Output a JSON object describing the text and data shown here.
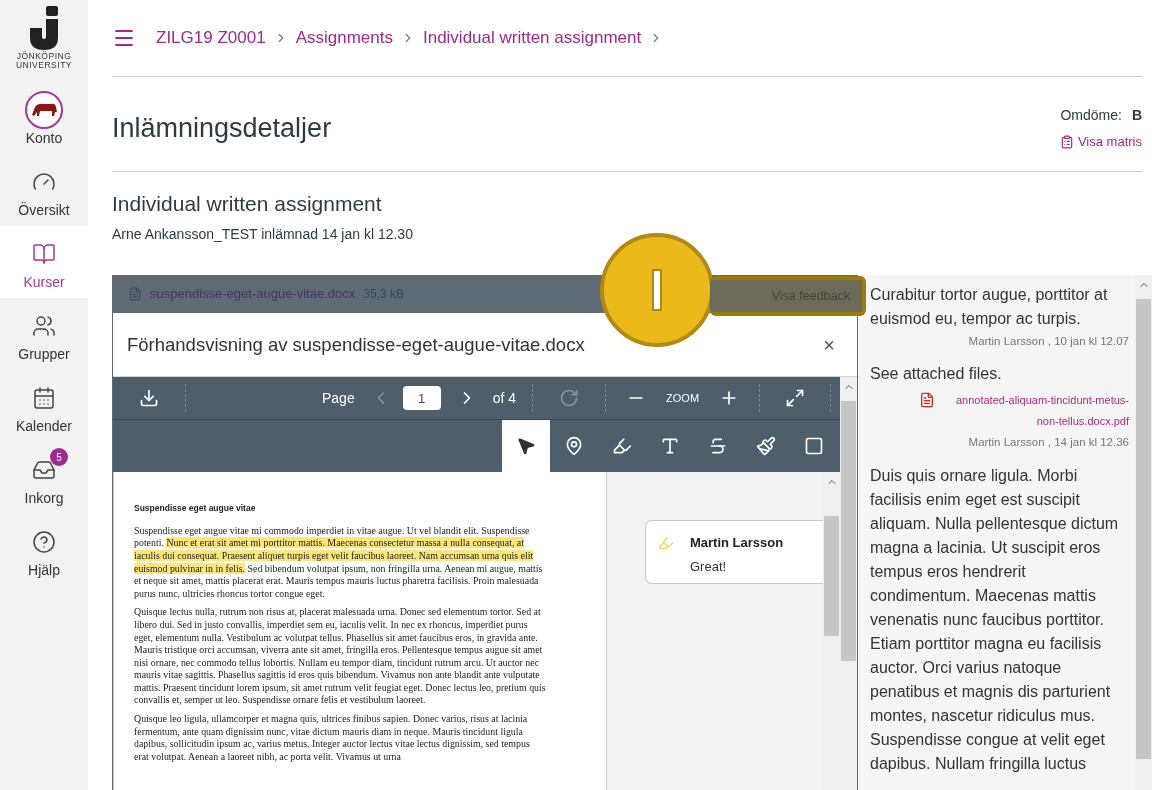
{
  "sidebar": {
    "logo_lines": [
      "JÖNKÖPING",
      "UNIVERSITY"
    ],
    "items": [
      {
        "kind": "avatar",
        "label": "Konto",
        "selected": false
      },
      {
        "kind": "dashboard",
        "label": "Översikt",
        "selected": false
      },
      {
        "kind": "courses",
        "label": "Kurser",
        "selected": true
      },
      {
        "kind": "groups",
        "label": "Grupper",
        "selected": false
      },
      {
        "kind": "calendar",
        "label": "Kalender",
        "selected": false
      },
      {
        "kind": "inbox",
        "label": "Inkorg",
        "selected": false,
        "badge": "5"
      },
      {
        "kind": "help",
        "label": "Hjälp",
        "selected": false
      }
    ]
  },
  "breadcrumb": [
    "ZILG19 Z0001",
    "Assignments",
    "Individual written assignment"
  ],
  "page_title": "Inlämningsdetaljer",
  "grade": {
    "label": "Omdöme:",
    "value": "B",
    "link": "Visa matris"
  },
  "assignment": {
    "title": "Individual written assignment",
    "submitted": "Arne Ankansson_TEST inlämnad 14 jan kl 12.30"
  },
  "file": {
    "name": "suspendisse-eget-augue-vitae.docx",
    "size": "35,3 kB",
    "feedback_button": "Visa feedback"
  },
  "preview": {
    "title": "Förhandsvisning av suspendisse-eget-augue-vitae.docx",
    "close": "×",
    "toolbar": {
      "page_label": "Page",
      "page": "1",
      "of": "of 4",
      "zoom": "ZOOM"
    },
    "tools": [
      {
        "kind": "select",
        "selected": true
      },
      {
        "kind": "point",
        "selected": false
      },
      {
        "kind": "highlight",
        "selected": false
      },
      {
        "kind": "text",
        "selected": false
      },
      {
        "kind": "strike",
        "selected": false
      },
      {
        "kind": "draw",
        "selected": false
      },
      {
        "kind": "area",
        "selected": false
      }
    ],
    "document": {
      "heading": "Suspendisse eget augue vitae",
      "paragraphs": [
        [
          {
            "text": "Suspendisse eget augue vitae mi commodo imperdiet in vitae augue. Ut vel blandit elit. Suspendisse potenti. ",
            "highlighted": false
          },
          {
            "text": "Nunc et erat sit amet mi porttitor mattis. Maecenas consectetur massa a nulla consequat, at iaculis dui consequat. Praesent aliquet turpis eget velit faucibus laoreet. Nam accumsan urna quis elit euismod pulvinar in in felis.",
            "highlighted": true
          },
          {
            "text": " Sed bibendum volutpat ipsum, non fringilla urna. Aenean mi augue, mattis et neque sit amet, mattis placerat erat. Mauris tempus mauris luctus pharetra facilisis. Proin malesuada purus nunc, ultricies rhoncus tortor congue eget.",
            "highlighted": false
          }
        ],
        [
          {
            "text": "Quisque lectus nulla, rutrum non risus at, placerat malesuada urna. Donec sed elementum tortor. Sed at libero dui. Sed in justo convallis, imperdiet sem eu, iaculis velit. In nec ex rhoncus, imperdiet purus eget, elementum nulla. Vestibulum ac volutpat tellus. Phasellus sit amet faucibus eros, in gravida ante. Mauris tristique orci accumsan, viverra ante sit amet, fringilla eros. Pellentesque tempus augue sit amet nisi ornare, nec commodo tellus lobortis. Nullam eu tempor diam, tincidunt rutrum arcu. Ut auctor nec mauris vitae sagittis. Phasellus sagittis id eros quis bibendum. Vivamus non ante blandit ante vulputate mattis. Praesent tincidunt lorem ipsum, sit amet rutrum velit feugiat eget. Donec lectus leo, pretium quis convallis et, semper ut leo. Suspendisse ornare felis et vestibulum laoreet.",
            "highlighted": false
          }
        ],
        [
          {
            "text": "Quisque leo ligula, ullamcorper et magna quis, ultrices finibus sapien. Donec varius, risus at lacinia fermentum, ante quam dignissim nunc, vitae dictum mauris diam in neque. Mauris tincidunt ligula dapibus, sollicitudin ipsum ac, varius metus. Integer auctor lectus vitae lectus dignissim, sed tempus erat volutpat. Aenean a laoreet nibh, ac porta velit. Vivamus ut urna",
            "highlighted": false
          }
        ]
      ]
    },
    "annotation": {
      "author": "Martin Larsson",
      "text": "Great!"
    }
  },
  "feedback": [
    {
      "kind": "text",
      "text": "Curabitur tortor augue, porttitor at euismod eu, tempor ac turpis.",
      "meta": "Martin Larsson , 10 jan kl 12.07"
    },
    {
      "kind": "attachment",
      "text": "See attached files.",
      "file": "annotated-aliquam-tincidunt-metus-non-tellus.docx.pdf",
      "meta": "Martin Larsson , 14 jan kl 12.36"
    },
    {
      "kind": "text",
      "text": "Duis quis ornare ligula. Morbi facilisis enim eget est suscipit aliquam. Nulla pellentesque dictum magna a lacinia. Ut suscipit eros tempus eros hendrerit condimentum. Maecenas mattis venenatis nunc faucibus porttitor. Etiam porttitor magna eu facilisis auctor. Orci varius natoque penatibus et magnis dis parturient montes, nascetur ridiculus mus. Suspendisse congue at velit eget dapibus. Nullam fringilla luctus"
    }
  ]
}
